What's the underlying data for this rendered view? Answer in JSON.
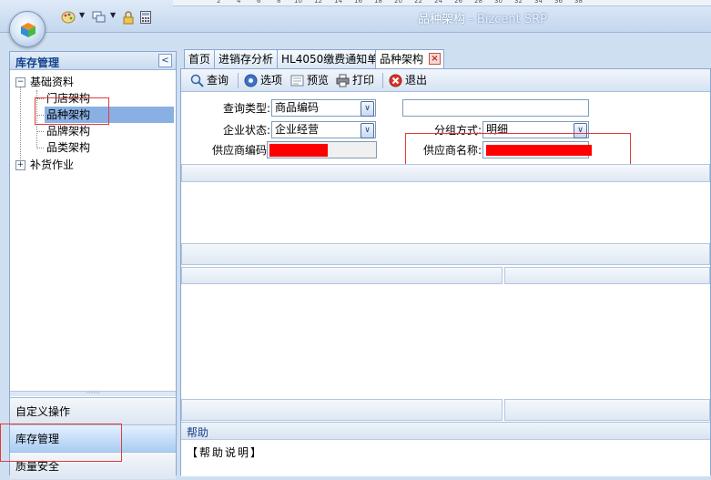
{
  "window": {
    "title_main": "品种架构",
    "title_sub": " - Bizcent SRP"
  },
  "ruler": {
    "ticks": [
      "4",
      "2",
      "2",
      "4",
      "6",
      "8",
      "10",
      "12",
      "14",
      "16",
      "18",
      "20",
      "22",
      "24",
      "26",
      "28",
      "30",
      "32",
      "34",
      "36",
      "38"
    ]
  },
  "left_panel": {
    "title": "库存管理",
    "collapse_glyph": "<",
    "tree": {
      "root1": {
        "label": "基础资料",
        "toggle": "−"
      },
      "children": [
        "门店架构",
        "品种架构",
        "品牌架构",
        "品类架构"
      ],
      "root2": {
        "label": "补货作业",
        "toggle": "+"
      }
    },
    "splitter_glyph": "······",
    "nav": [
      "自定义操作",
      "库存管理",
      "质量安全"
    ]
  },
  "tabs": [
    {
      "label": "首页"
    },
    {
      "label": "进销存分析"
    },
    {
      "label": "HL4050缴费通知单"
    },
    {
      "label": "品种架构"
    }
  ],
  "tab_close_glyph": "×",
  "toolbar": {
    "query": "查询",
    "options": "选项",
    "preview": "预览",
    "print": "打印",
    "exit": "退出"
  },
  "form": {
    "query_type_label": "查询类型:",
    "query_type_value": "商品编码",
    "status_label": "企业状态:",
    "status_value": "企业经营",
    "group_label": "分组方式:",
    "group_value": "明细",
    "supplier_code_label": "供应商编码",
    "supplier_name_label": "供应商名称:",
    "dropdown_glyph": "∨"
  },
  "help": {
    "title": "帮助",
    "body": "【帮助说明】"
  },
  "colors": {
    "accent": "#15428b",
    "redaction": "#ff0000",
    "annotation": "#e23a3a",
    "selection": "#8ab0e3"
  }
}
